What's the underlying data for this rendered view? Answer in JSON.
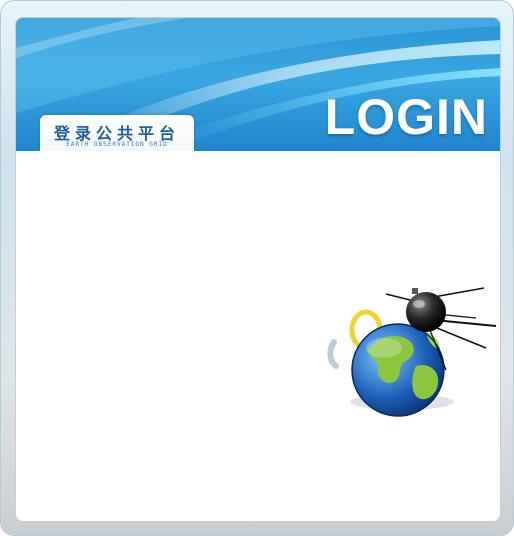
{
  "header": {
    "title": "LOGIN",
    "platform_name": "登录公共平台",
    "platform_subtitle": "EARTH OBSERVATION GRID"
  },
  "illustration": {
    "icon": "globe-satellite-icon"
  },
  "colors": {
    "banner_blue": "#2b93d6",
    "tab_text": "#1f5fa0",
    "frame_border": "#c8cdd1"
  }
}
